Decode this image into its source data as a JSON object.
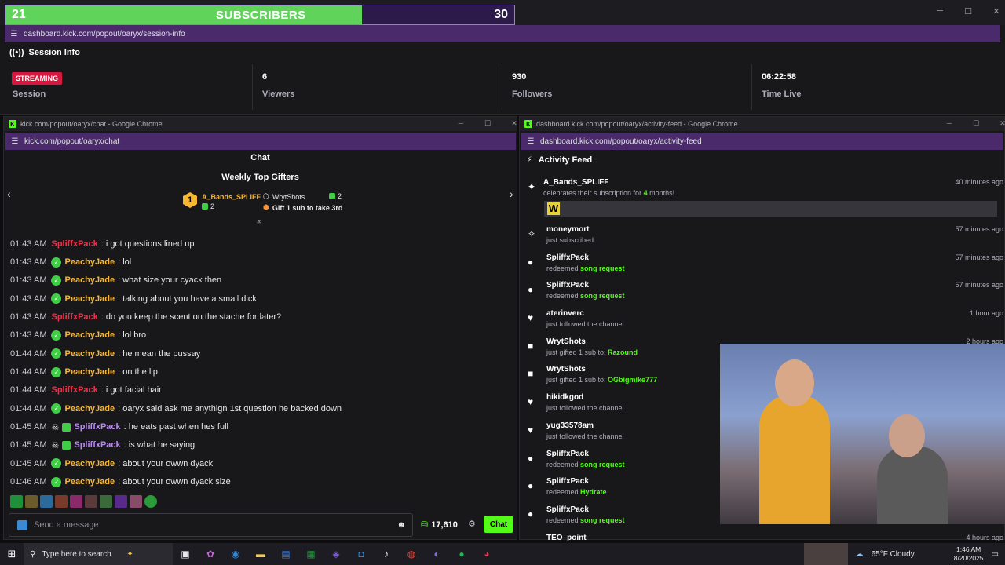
{
  "subs_widget": {
    "current": "21",
    "title": "SUBSCRIBERS",
    "goal": "30",
    "progress": 0.7,
    "fill_color": "#5fd35a"
  },
  "session_window": {
    "url": "dashboard.kick.com/popout/oaryx/session-info",
    "heading": "Session Info",
    "status_badge": "STREAMING",
    "stats": [
      {
        "value": "",
        "label": "Session"
      },
      {
        "value": "6",
        "label": "Viewers"
      },
      {
        "value": "930",
        "label": "Followers"
      },
      {
        "value": "06:22:58",
        "label": "Time Live"
      }
    ]
  },
  "chat_window": {
    "caption": "kick.com/popout/oaryx/chat - Google Chrome",
    "url": "kick.com/popout/oaryx/chat",
    "title": "Chat",
    "gifters_title": "Weekly Top Gifters",
    "gifters": [
      {
        "rank": "1",
        "name": "A_Bands_SPLIFF",
        "count": "2"
      },
      {
        "name": "WrytShots",
        "count": "2"
      }
    ],
    "gift_cta": "Gift 1 sub to take 3rd",
    "messages": [
      {
        "time": "01:43 AM",
        "user": "SpliffxPack",
        "color": "#e8364f",
        "badges": "none",
        "text": "i got questions lined up"
      },
      {
        "time": "01:43 AM",
        "user": "PeachyJade",
        "color": "#f7b733",
        "badges": "check",
        "text": "lol"
      },
      {
        "time": "01:43 AM",
        "user": "PeachyJade",
        "color": "#f7b733",
        "badges": "check",
        "text": "what size your cyack then"
      },
      {
        "time": "01:43 AM",
        "user": "PeachyJade",
        "color": "#f7b733",
        "badges": "check",
        "text": "talking about you have a small dick"
      },
      {
        "time": "01:43 AM",
        "user": "SpliffxPack",
        "color": "#e8364f",
        "badges": "none",
        "text": "do you keep the scent on the stache for later?"
      },
      {
        "time": "01:43 AM",
        "user": "PeachyJade",
        "color": "#f7b733",
        "badges": "check",
        "text": "lol bro"
      },
      {
        "time": "01:44 AM",
        "user": "PeachyJade",
        "color": "#f7b733",
        "badges": "check",
        "text": "he mean the pussay"
      },
      {
        "time": "01:44 AM",
        "user": "PeachyJade",
        "color": "#f7b733",
        "badges": "check",
        "text": "on the lip"
      },
      {
        "time": "01:44 AM",
        "user": "SpliffxPack",
        "color": "#e8364f",
        "badges": "none",
        "text": "i got facial hair"
      },
      {
        "time": "01:44 AM",
        "user": "PeachyJade",
        "color": "#f7b733",
        "badges": "check",
        "text": "oaryx said ask me anythign 1st question he backed down"
      },
      {
        "time": "01:45 AM",
        "user": "SpliffxPack",
        "color": "#b98af0",
        "badges": "skull-gift",
        "text": "he eats past when hes full"
      },
      {
        "time": "01:45 AM",
        "user": "SpliffxPack",
        "color": "#b98af0",
        "badges": "skull-gift",
        "text": "is what he saying"
      },
      {
        "time": "01:45 AM",
        "user": "PeachyJade",
        "color": "#f7b733",
        "badges": "check",
        "text": "about your owwn dyack"
      },
      {
        "time": "01:46 AM",
        "user": "PeachyJade",
        "color": "#f7b733",
        "badges": "check",
        "text": "about your owwn dyack size"
      }
    ],
    "input_placeholder": "Send a message",
    "points": "17,610",
    "send_label": "Chat"
  },
  "feed_window": {
    "caption": "dashboard.kick.com/popout/oaryx/activity-feed - Google Chrome",
    "url": "dashboard.kick.com/popout/oaryx/activity-feed",
    "title": "Activity Feed",
    "items": [
      {
        "icon": "✦",
        "name": "A_Bands_SPLIFF",
        "pre": "celebrates their subscription for ",
        "hl": "4",
        "post": " months!",
        "when": "40 minutes ago",
        "emote": "W"
      },
      {
        "icon": "✧",
        "name": "moneymort",
        "pre": "just subscribed",
        "hl": "",
        "post": "",
        "when": "57 minutes ago"
      },
      {
        "icon": "●",
        "name": "SpliffxPack",
        "pre": "redeemed ",
        "hl": "song request",
        "post": "",
        "when": "57 minutes ago"
      },
      {
        "icon": "●",
        "name": "SpliffxPack",
        "pre": "redeemed ",
        "hl": "song request",
        "post": "",
        "when": "57 minutes ago"
      },
      {
        "icon": "♥",
        "name": "aterinverc",
        "pre": "just followed the channel",
        "hl": "",
        "post": "",
        "when": "1 hour ago"
      },
      {
        "icon": "■",
        "name": "WrytShots",
        "pre": "just gifted 1 sub to: ",
        "hl": "Razound",
        "post": "",
        "when": "2 hours ago"
      },
      {
        "icon": "■",
        "name": "WrytShots",
        "pre": "just gifted 1 sub to: ",
        "hl": "OGbigmike777",
        "post": "",
        "when": ""
      },
      {
        "icon": "♥",
        "name": "hikidkgod",
        "pre": "just followed the channel",
        "hl": "",
        "post": "",
        "when": ""
      },
      {
        "icon": "♥",
        "name": "yug33578am",
        "pre": "just followed the channel",
        "hl": "",
        "post": "",
        "when": ""
      },
      {
        "icon": "●",
        "name": "SpliffxPack",
        "pre": "redeemed ",
        "hl": "song request",
        "post": "",
        "when": ""
      },
      {
        "icon": "●",
        "name": "SpliffxPack",
        "pre": "redeemed ",
        "hl": "Hydrate",
        "post": "",
        "when": ""
      },
      {
        "icon": "●",
        "name": "SpliffxPack",
        "pre": "redeemed ",
        "hl": "song request",
        "post": "",
        "when": ""
      },
      {
        "icon": "",
        "name": "TEO_point",
        "pre": "",
        "hl": "",
        "post": "",
        "when": "4 hours ago"
      }
    ]
  },
  "taskbar": {
    "search_placeholder": "Type here to search",
    "weather": "65°F  Cloudy",
    "time": "1:46 AM",
    "date": "8/20/2025"
  },
  "colors": {
    "kick_green": "#53fc18",
    "url_purple": "#4a2a6b",
    "live_red": "#d6183e"
  }
}
